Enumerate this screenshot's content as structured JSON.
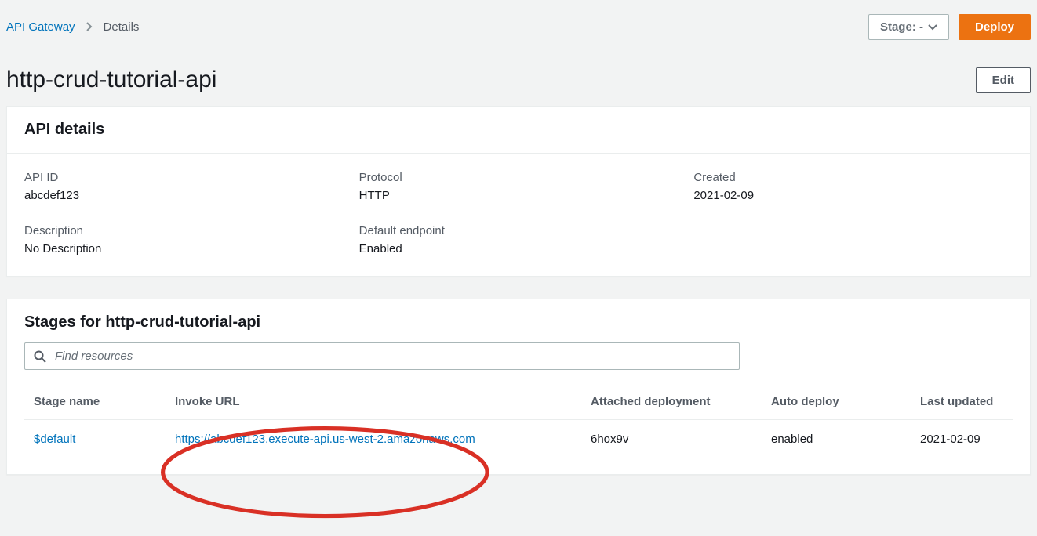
{
  "breadcrumb": {
    "root": "API Gateway",
    "current": "Details"
  },
  "actions": {
    "stage_label": "Stage: -",
    "deploy": "Deploy",
    "edit": "Edit"
  },
  "page_title": "http-crud-tutorial-api",
  "api_details": {
    "heading": "API details",
    "fields": {
      "api_id": {
        "label": "API ID",
        "value": "abcdef123"
      },
      "protocol": {
        "label": "Protocol",
        "value": "HTTP"
      },
      "created": {
        "label": "Created",
        "value": "2021-02-09"
      },
      "description": {
        "label": "Description",
        "value": "No Description"
      },
      "default_endpoint": {
        "label": "Default endpoint",
        "value": "Enabled"
      }
    }
  },
  "stages_panel": {
    "heading": "Stages for http-crud-tutorial-api",
    "search_placeholder": "Find resources",
    "columns": {
      "stage_name": "Stage name",
      "invoke_url": "Invoke URL",
      "attached_deployment": "Attached deployment",
      "auto_deploy": "Auto deploy",
      "last_updated": "Last updated"
    },
    "rows": [
      {
        "stage_name": "$default",
        "invoke_url": "https://abcdef123.execute-api.us-west-2.amazonaws.com",
        "attached_deployment": "6hox9v",
        "auto_deploy": "enabled",
        "last_updated": "2021-02-09"
      }
    ]
  }
}
